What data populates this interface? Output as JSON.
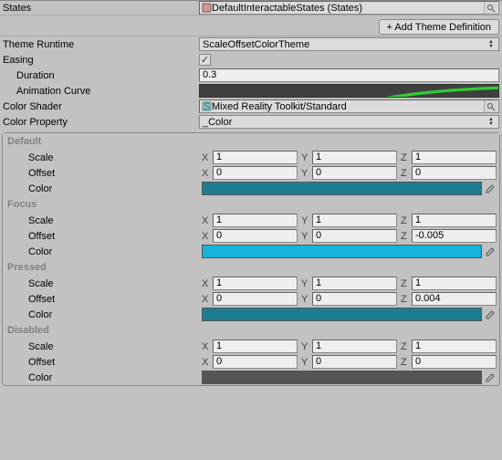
{
  "top": {
    "statesLabel": "States",
    "statesValue": "DefaultInteractableStates (States)",
    "addThemeBtn": "+ Add Theme Definition"
  },
  "theme": {
    "runtimeLabel": "Theme Runtime",
    "runtimeValue": "ScaleOffsetColorTheme",
    "easingLabel": "Easing",
    "easingChecked": "✓",
    "durationLabel": "Duration",
    "durationValue": "0.3",
    "curveLabel": "Animation Curve",
    "shaderLabel": "Color Shader",
    "shaderValue": "Mixed Reality Toolkit/Standard",
    "colorPropLabel": "Color Property",
    "colorPropValue": "_Color"
  },
  "states": [
    {
      "name": "Default",
      "scale": {
        "x": "1",
        "y": "1",
        "z": "1"
      },
      "offset": {
        "x": "0",
        "y": "0",
        "z": "0"
      },
      "color": "#1e7d91"
    },
    {
      "name": "Focus",
      "scale": {
        "x": "1",
        "y": "1",
        "z": "1"
      },
      "offset": {
        "x": "0",
        "y": "0",
        "z": "-0.005"
      },
      "color": "#15b4d8"
    },
    {
      "name": "Pressed",
      "scale": {
        "x": "1",
        "y": "1",
        "z": "1"
      },
      "offset": {
        "x": "0",
        "y": "0",
        "z": "0.004"
      },
      "color": "#1e7d91"
    },
    {
      "name": "Disabled",
      "scale": {
        "x": "1",
        "y": "1",
        "z": "1"
      },
      "offset": {
        "x": "0",
        "y": "0",
        "z": "0"
      },
      "color": "#555555"
    }
  ],
  "labels": {
    "scale": "Scale",
    "offset": "Offset",
    "color": "Color",
    "x": "X",
    "y": "Y",
    "z": "Z"
  }
}
